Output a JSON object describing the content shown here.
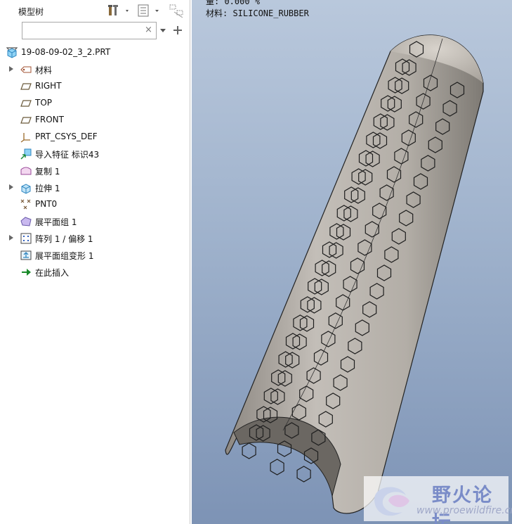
{
  "panel": {
    "title": "模型树",
    "search": {
      "value": "",
      "clear": "×"
    }
  },
  "tree": {
    "items": [
      {
        "label": "19-08-09-02_3_2.PRT",
        "icon": "part-icon",
        "expand": false
      },
      {
        "label": "材料",
        "icon": "material-icon",
        "expand": true
      },
      {
        "label": "RIGHT",
        "icon": "datum-plane-icon",
        "expand": false
      },
      {
        "label": "TOP",
        "icon": "datum-plane-icon",
        "expand": false
      },
      {
        "label": "FRONT",
        "icon": "datum-plane-icon",
        "expand": false
      },
      {
        "label": "PRT_CSYS_DEF",
        "icon": "coordinate-system-icon",
        "expand": false
      },
      {
        "label": "导入特征 标识43",
        "icon": "import-feature-icon",
        "expand": false
      },
      {
        "label": "复制 1",
        "icon": "copy-icon",
        "expand": false
      },
      {
        "label": "拉伸 1",
        "icon": "extrude-icon",
        "expand": true
      },
      {
        "label": "PNT0",
        "icon": "datum-point-icon",
        "expand": false
      },
      {
        "label": "展平面组 1",
        "icon": "flatten-quilt-icon",
        "expand": false
      },
      {
        "label": "阵列 1 / 偏移 1",
        "icon": "pattern-icon",
        "expand": true
      },
      {
        "label": "展平面组变形 1",
        "icon": "flatten-deform-icon",
        "expand": false
      },
      {
        "label": "在此插入",
        "icon": "insert-here-arrow-icon",
        "expand": false
      }
    ]
  },
  "viewport": {
    "info_line1": "量: 0.000 %",
    "info_line2": "材料: SILICONE_RUBBER"
  },
  "watermark": {
    "name": "野火论坛",
    "url": "www.proewildfire.cn"
  },
  "colors": {
    "model_fill": "#b9b4ad",
    "background_top": "#b9c8dc",
    "background_bottom": "#7d93b5"
  }
}
